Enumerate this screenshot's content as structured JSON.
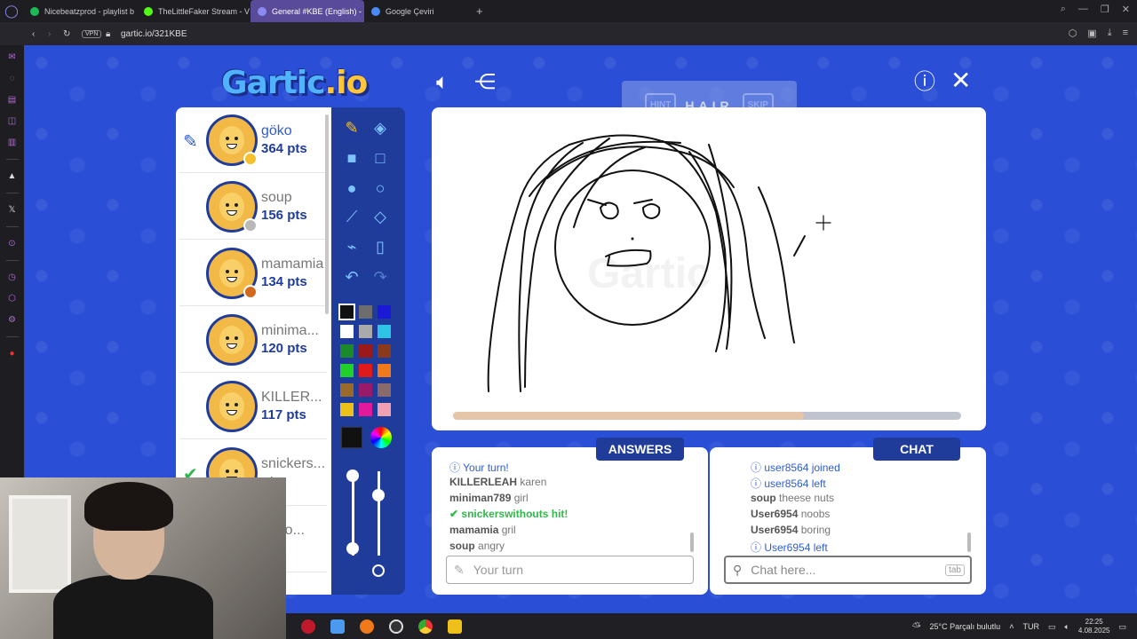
{
  "browser": {
    "tabs": [
      {
        "title": "Nicebeatzprod - playlist b",
        "color": "#1db954",
        "active": false
      },
      {
        "title": "TheLittleFaker Stream - V",
        "color": "#53fc18",
        "active": false
      },
      {
        "title": "General #KBE (English) -",
        "color": "#8a8af0",
        "active": true
      },
      {
        "title": "Google Çeviri",
        "color": "#4a8af4",
        "active": false
      }
    ],
    "vpn_label": "VPN",
    "url": "gartic.io/321KBE"
  },
  "game": {
    "logo_main": "Gartic",
    "logo_suffix": ".io",
    "hint": {
      "hint_label": "HINT",
      "word": "HAIR",
      "skip_label": "SKIP"
    },
    "players": [
      {
        "name": "göko",
        "pts": "364 pts",
        "badge": "#f5c02c",
        "drawing": true,
        "hit": false
      },
      {
        "name": "soup",
        "pts": "156 pts",
        "badge": "#b9b9b9",
        "drawing": false,
        "hit": false
      },
      {
        "name": "mamamia",
        "pts": "134 pts",
        "badge": "#d2691e",
        "drawing": false,
        "hit": false
      },
      {
        "name": "minima...",
        "pts": "120 pts",
        "badge": "",
        "drawing": false,
        "hit": false
      },
      {
        "name": "KILLER...",
        "pts": "117 pts",
        "badge": "",
        "drawing": false,
        "hit": false
      },
      {
        "name": "snickers...",
        "pts": "pts",
        "badge": "",
        "drawing": false,
        "hit": true
      },
      {
        "name": "mofo...",
        "pts": "pts",
        "badge": "",
        "drawing": false,
        "hit": false
      }
    ],
    "palette": [
      "#111111",
      "#6d6d6d",
      "#1a1ad6",
      "#ffffff",
      "#aaaaaa",
      "#2ec4e6",
      "#1a8a2a",
      "#9a1a1a",
      "#8a3a1a",
      "#22d02a",
      "#e01a1a",
      "#f07a1a",
      "#9a6a2a",
      "#9a1a6a",
      "#8a6a6a",
      "#f0c01a",
      "#e01a9a",
      "#f0a0b0"
    ],
    "current_color": "#111111",
    "round_progress": 0.69,
    "answers": {
      "title": "ANSWERS",
      "messages": [
        {
          "user": "",
          "text": "Your turn!",
          "kind": "info"
        },
        {
          "user": "KILLERLEAH",
          "text": "karen",
          "kind": "msg"
        },
        {
          "user": "miniman789",
          "text": "girl",
          "kind": "msg"
        },
        {
          "user": "",
          "text": "snickerswithouts hit!",
          "kind": "hit"
        },
        {
          "user": "mamamia",
          "text": "gril",
          "kind": "msg"
        },
        {
          "user": "soup",
          "text": "angry",
          "kind": "msg"
        }
      ],
      "input_placeholder": "Your turn"
    },
    "chat": {
      "title": "CHAT",
      "messages": [
        {
          "user": "",
          "text": "user8564 joined",
          "kind": "info"
        },
        {
          "user": "",
          "text": "user8564 left",
          "kind": "info"
        },
        {
          "user": "soup",
          "text": "theese nuts",
          "kind": "msg"
        },
        {
          "user": "User6954",
          "text": "noobs",
          "kind": "msg"
        },
        {
          "user": "User6954",
          "text": "boring",
          "kind": "msg"
        },
        {
          "user": "",
          "text": "User6954 left",
          "kind": "info"
        }
      ],
      "input_placeholder": "Chat here...",
      "tab_key": "tab"
    }
  },
  "taskbar": {
    "weather": "25°C  Parçalı bulutlu",
    "lang": "TUR",
    "time": "22:25",
    "date": "4.08.2025"
  }
}
